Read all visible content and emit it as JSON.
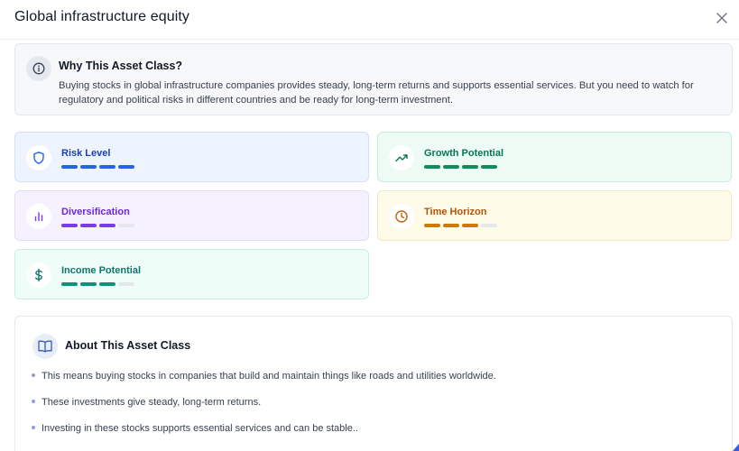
{
  "header": {
    "title": "Global infrastructure equity"
  },
  "why": {
    "title": "Why This Asset Class?",
    "body": "Buying stocks in global infrastructure companies provides steady, long-term returns and supports essential services. But you need to watch for regulatory and political risks in different countries and be ready for long-term investment."
  },
  "metrics": [
    {
      "label": "Risk Level",
      "level": 4,
      "max": 4,
      "icon": "shield-icon",
      "color": "#2563eb",
      "bg": "#eef4ff",
      "border": "#d4e0f7",
      "text": "#1e40af"
    },
    {
      "label": "Growth Potential",
      "level": 4,
      "max": 4,
      "icon": "trending-up-icon",
      "color": "#0b8f5a",
      "bg": "#edfbf4",
      "border": "#c9eedd",
      "text": "#047857"
    },
    {
      "label": "Diversification",
      "level": 3,
      "max": 4,
      "icon": "bar-chart-icon",
      "color": "#7c3aed",
      "bg": "#f5f1ff",
      "border": "#e3dbf8",
      "text": "#6d28d9"
    },
    {
      "label": "Time Horizon",
      "level": 3,
      "max": 4,
      "icon": "clock-icon",
      "color": "#cf7a07",
      "bg": "#fffbe9",
      "border": "#f3e8be",
      "text": "#b45309"
    },
    {
      "label": "Income Potential",
      "level": 3,
      "max": 4,
      "icon": "dollar-icon",
      "color": "#0d9477",
      "bg": "#eefdf7",
      "border": "#c9efe2",
      "text": "#0f766e"
    }
  ],
  "about": {
    "title": "About This Asset Class",
    "bullets": [
      "This means buying stocks in companies that build and maintain things like roads and utilities worldwide.",
      "These investments give steady, long-term returns.",
      "Investing in these stocks supports essential services and can be stable.."
    ]
  }
}
